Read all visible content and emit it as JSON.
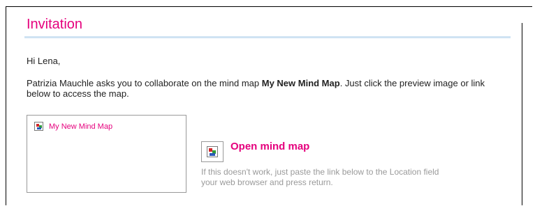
{
  "email": {
    "title": "Invitation",
    "greeting": "Hi Lena,",
    "message_before": "Patrizia Mauchle asks you to collaborate on the mind map ",
    "map_name": "My New Mind Map",
    "message_after": ". Just click the preview image or link below to access the map.",
    "preview_link": "My New Mind Map",
    "open_link": "Open mind map",
    "hint_line1": "If this doesn't work, just paste the link below to the Location field",
    "hint_line2": "your web browser and press return."
  },
  "colors": {
    "accent": "#e5007d",
    "rule": "#cfe3f3",
    "hint": "#9a9a9a"
  },
  "icons": {
    "preview_image": "broken-image-icon",
    "open_image": "broken-image-icon"
  }
}
